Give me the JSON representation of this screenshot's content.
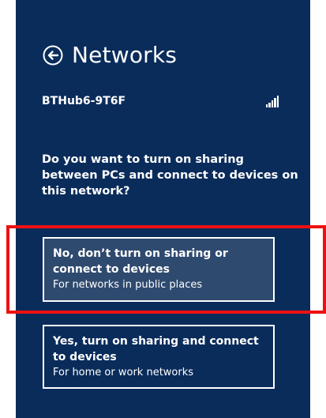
{
  "header": {
    "title": "Networks",
    "back_icon": "back-arrow-circle-icon"
  },
  "network": {
    "name": "BTHub6-9T6F",
    "signal_icon": "wifi-signal-icon",
    "signal_bars": 5
  },
  "prompt": {
    "question": "Do you want to turn on sharing between PCs and connect to devices on this network?"
  },
  "options": [
    {
      "title": "No, don’t turn on sharing or connect to devices",
      "subtitle": "For networks in public places"
    },
    {
      "title": "Yes, turn on sharing and connect to devices",
      "subtitle": "For home or work networks"
    }
  ],
  "colors": {
    "panel_background": "#0a2c5b",
    "selected_option_background": "#2f4a6f",
    "highlight_frame": "#ee1111",
    "text": "#ffffff"
  }
}
